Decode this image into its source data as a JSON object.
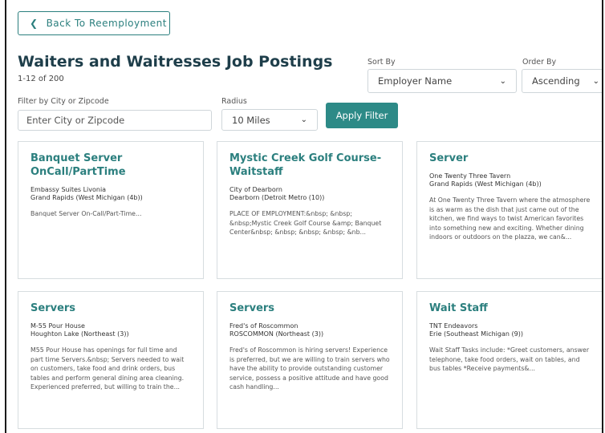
{
  "back_button": {
    "label": "Back To Reemployment"
  },
  "header": {
    "title": "Waiters and Waitresses Job Postings",
    "count": "1-12 of 200"
  },
  "sort_by": {
    "label": "Sort By",
    "value": "Employer Name"
  },
  "order_by": {
    "label": "Order By",
    "value": "Ascending"
  },
  "filter": {
    "city_label": "Filter by City or Zipcode",
    "city_placeholder": "Enter City or Zipcode",
    "radius_label": "Radius",
    "radius_value": "10 Miles",
    "apply_label": "Apply Filter"
  },
  "icons": {
    "back": "chevron-left-icon",
    "dropdown": "chevron-down-icon"
  },
  "colors": {
    "accent": "#2b7f7e",
    "title": "#1e3e4a",
    "button_bg": "#2d8a87"
  },
  "jobs": [
    {
      "title": "Banquet Server OnCall/PartTime",
      "company": "Embassy Suites Livonia",
      "location": "Grand Rapids (West Michigan (4b))",
      "description": "Banquet Server On-Call/Part-Time..."
    },
    {
      "title": "Mystic Creek Golf Course- Waitstaff",
      "company": "City of Dearborn",
      "location": "Dearborn (Detroit Metro (10))",
      "description": "PLACE OF EMPLOYMENT:&nbsp; &nbsp; &nbsp;Mystic Creek Golf Course &amp; Banquet Center&nbsp; &nbsp; &nbsp; &nbsp; &nb..."
    },
    {
      "title": "Server",
      "company": "One Twenty Three Tavern",
      "location": "Grand Rapids (West Michigan (4b))",
      "description": "At One Twenty Three Tavern where the atmosphere is as warm as the dish that just came out of the kitchen, we find ways to twist American favorites into something new and exciting. Whether dining indoors or outdoors on the plazza, we can&..."
    },
    {
      "title": "Servers",
      "company": "M-55 Pour House",
      "location": "Houghton Lake (Northeast (3))",
      "description": "M55 Pour House has openings for full time and part time Servers.&nbsp; Servers needed to wait on customers, take food and drink orders, bus tables and perform general dining area cleaning. Experienced preferred, but willing to train the..."
    },
    {
      "title": "Servers",
      "company": "Fred's of Roscommon",
      "location": "ROSCOMMON (Northeast (3))",
      "description": "Fred's of Roscommon is hiring servers! Experience is preferred, but we are willing to train servers who have the ability to provide outstanding customer service, possess a positive attitude and have good cash handling..."
    },
    {
      "title": "Wait Staff",
      "company": "TNT Endeavors",
      "location": "Erie (Southeast Michigan (9))",
      "description": "Wait Staff Tasks include: *Greet customers, answer telephone, take food orders, wait on tables, and bus tables *Receive payments&..."
    }
  ]
}
